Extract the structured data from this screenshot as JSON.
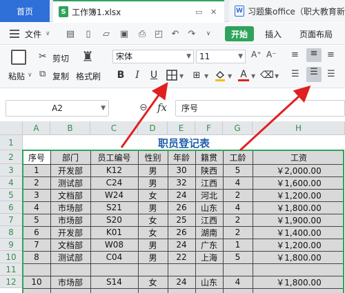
{
  "tabs": {
    "home": "首页",
    "workbook": "工作簿1.xlsx",
    "doc": "习题集office（职大教育新"
  },
  "menu": {
    "file": "文件",
    "start": "开始",
    "insert": "插入",
    "page_layout": "页面布局"
  },
  "ribbon": {
    "paste": "粘贴",
    "cut": "剪切",
    "copy": "复制",
    "format_painter": "格式刷",
    "font_name": "宋体",
    "font_size": "11",
    "bold": "B",
    "italic": "I",
    "underline": "U",
    "font_color_letter": "A"
  },
  "formula_bar": {
    "name_box": "A2",
    "fx": "fx",
    "content": "序号"
  },
  "columns": [
    "A",
    "B",
    "C",
    "D",
    "E",
    "F",
    "G",
    "H"
  ],
  "rows": [
    "1",
    "2",
    "3",
    "4",
    "5",
    "6",
    "7",
    "8",
    "9",
    "10",
    "11",
    "12"
  ],
  "sheet": {
    "title": "职员登记表",
    "headers": [
      "序号",
      "部门",
      "员工编号",
      "性别",
      "年龄",
      "籍贯",
      "工龄",
      "工资"
    ],
    "records": [
      [
        "1",
        "开发部",
        "K12",
        "男",
        "30",
        "陕西",
        "5",
        "￥2,000.00"
      ],
      [
        "2",
        "测试部",
        "C24",
        "男",
        "32",
        "江西",
        "4",
        "￥1,600.00"
      ],
      [
        "3",
        "文档部",
        "W24",
        "女",
        "24",
        "河北",
        "2",
        "￥1,200.00"
      ],
      [
        "4",
        "市场部",
        "S21",
        "男",
        "26",
        "山东",
        "4",
        "￥1,800.00"
      ],
      [
        "5",
        "市场部",
        "S20",
        "女",
        "25",
        "江西",
        "2",
        "￥1,900.00"
      ],
      [
        "6",
        "开发部",
        "K01",
        "女",
        "26",
        "湖南",
        "2",
        "￥1,400.00"
      ],
      [
        "7",
        "文档部",
        "W08",
        "男",
        "24",
        "广东",
        "1",
        "￥1,200.00"
      ],
      [
        "8",
        "测试部",
        "C04",
        "男",
        "22",
        "上海",
        "5",
        "￥1,800.00"
      ],
      [
        "",
        "",
        "",
        "",
        "",
        "",
        "",
        ""
      ],
      [
        "10",
        "市场部",
        "S14",
        "女",
        "24",
        "山东",
        "4",
        "￥1,800.00"
      ]
    ]
  },
  "colors": {
    "accent_green": "#2fa35c",
    "title_blue": "#1f5fae",
    "arrow_red": "#e02020"
  }
}
